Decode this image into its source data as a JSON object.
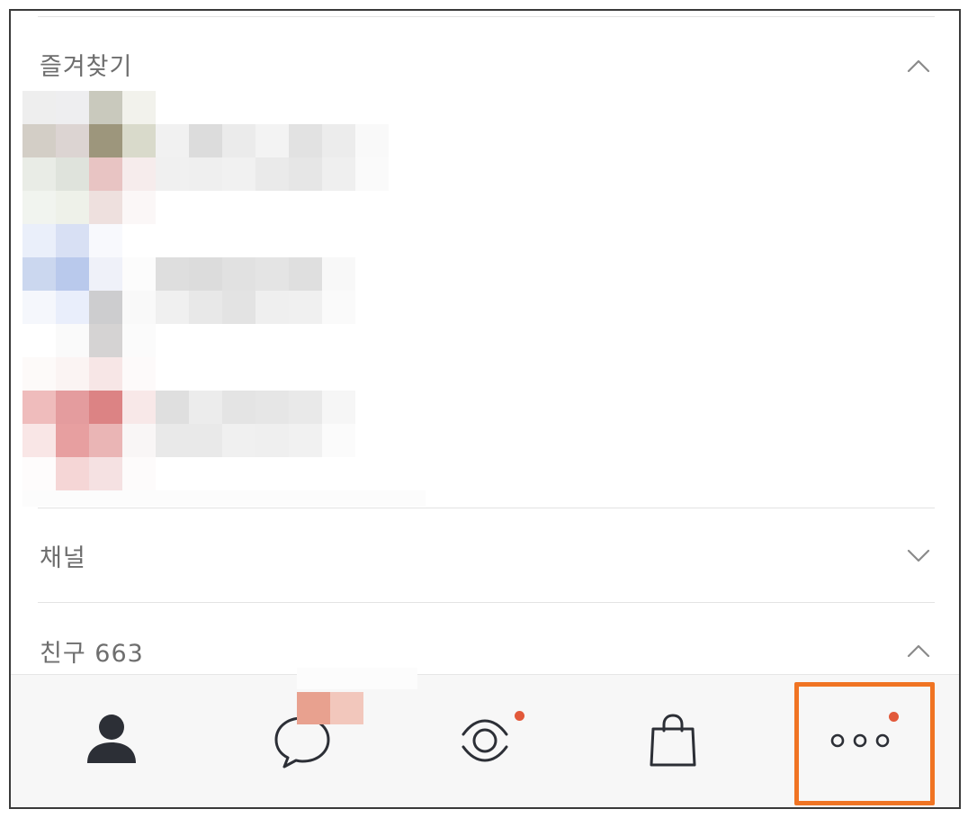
{
  "sections": {
    "favorites": {
      "title": "즐겨찾기",
      "state": "expanded"
    },
    "channel": {
      "title": "채널",
      "state": "collapsed"
    },
    "friends": {
      "title": "친구 663",
      "state": "expanded"
    }
  },
  "icons": {
    "favorites_toggle": "chevron-up-icon",
    "channel_toggle": "chevron-down-icon",
    "friends_toggle": "chevron-up-icon"
  },
  "tabbar": {
    "tabs": [
      {
        "name": "friends",
        "icon": "person-icon",
        "badge": false
      },
      {
        "name": "chats",
        "icon": "speech-bubble-icon",
        "badge": false
      },
      {
        "name": "view",
        "icon": "eye-icon",
        "badge": true
      },
      {
        "name": "shopping",
        "icon": "shopping-bag-icon",
        "badge": false
      },
      {
        "name": "more",
        "icon": "more-dots-icon",
        "badge": true,
        "highlighted": true
      }
    ]
  },
  "colors": {
    "badge": "#e2593a",
    "highlight_border": "#f07423",
    "icon_dark": "#2c2f36",
    "title_text": "#6e6e6e"
  }
}
